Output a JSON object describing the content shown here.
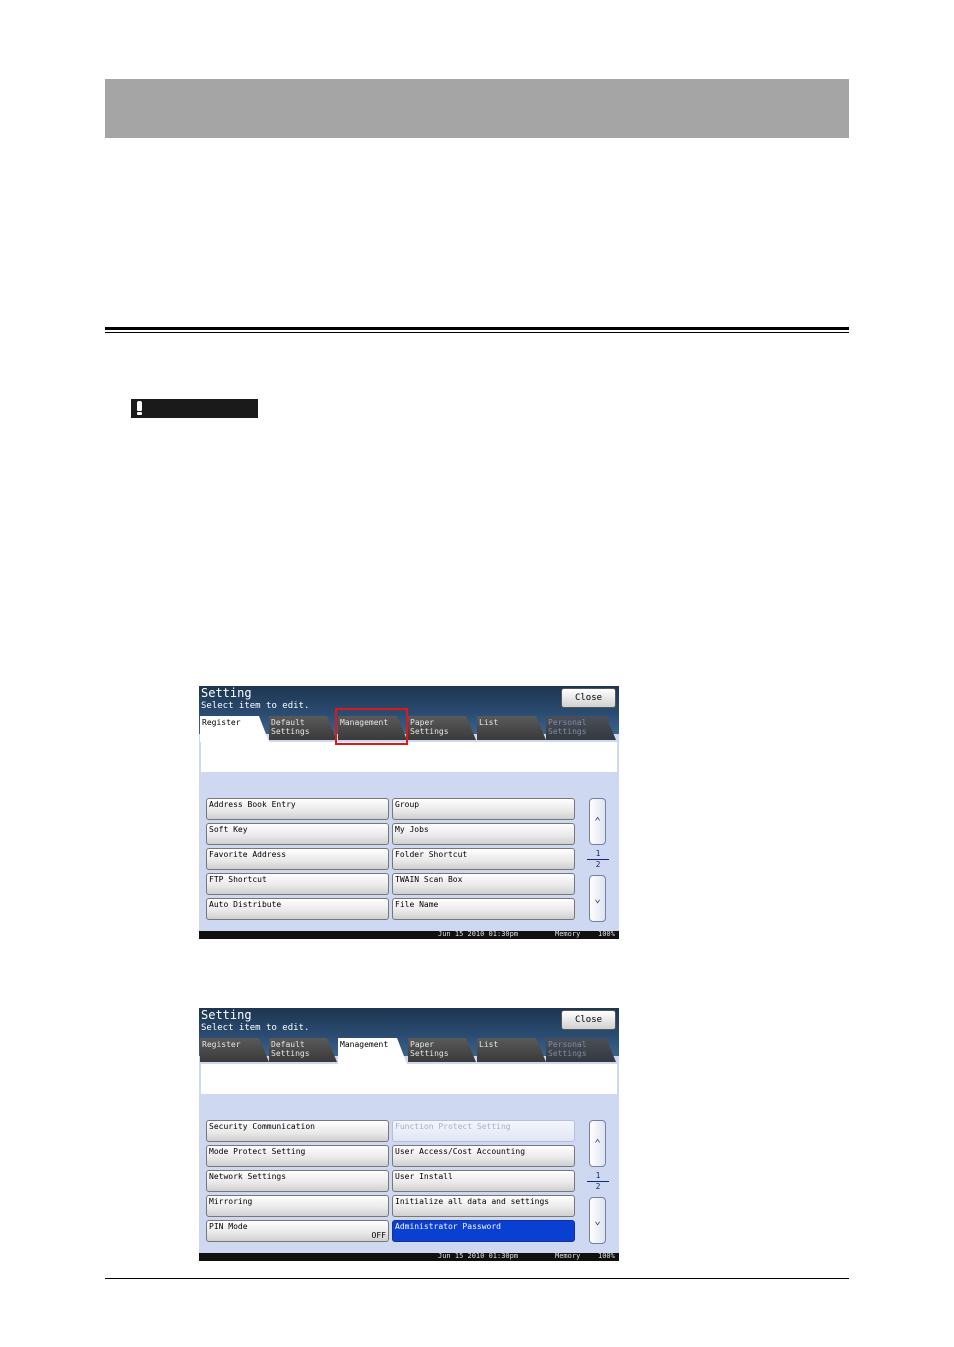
{
  "screenshot1": {
    "title": "Setting",
    "subtitle": "Select item to edit.",
    "close_label": "Close",
    "tabs": [
      {
        "l1": "Register",
        "l2": ""
      },
      {
        "l1": "Default",
        "l2": "Settings"
      },
      {
        "l1": "Management",
        "l2": ""
      },
      {
        "l1": "Paper",
        "l2": "Settings"
      },
      {
        "l1": "List",
        "l2": ""
      },
      {
        "l1": "Personal",
        "l2": "Settings"
      }
    ],
    "active_tab": "Register",
    "buttons_left": [
      "Address Book Entry",
      "Soft Key",
      "Favorite Address",
      "FTP Shortcut",
      "Auto Distribute"
    ],
    "buttons_right": [
      "Group",
      "My Jobs",
      "Folder Shortcut",
      "TWAIN Scan Box",
      "File Name"
    ],
    "page_current": "1",
    "page_total": "2",
    "status_date": "Jun 15 2010 01:30pm",
    "status_memory": "Memory",
    "status_percent": "100%"
  },
  "screenshot2": {
    "title": "Setting",
    "subtitle": "Select item to edit.",
    "close_label": "Close",
    "tabs": [
      {
        "l1": "Register",
        "l2": ""
      },
      {
        "l1": "Default",
        "l2": "Settings"
      },
      {
        "l1": "Management",
        "l2": ""
      },
      {
        "l1": "Paper",
        "l2": "Settings"
      },
      {
        "l1": "List",
        "l2": ""
      },
      {
        "l1": "Personal",
        "l2": "Settings"
      }
    ],
    "active_tab": "Management",
    "buttons_left": [
      "Security Communication",
      "Mode Protect Setting",
      "Network Settings",
      "Mirroring",
      "PIN Mode"
    ],
    "pin_mode_value": "OFF",
    "buttons_right": [
      "Function Protect Setting",
      "User Access/Cost Accounting",
      "User Install",
      "Initialize all data and settings",
      "Administrator Password"
    ],
    "page_current": "1",
    "page_total": "2",
    "status_date": "Jun 15 2010 01:30pm",
    "status_memory": "Memory",
    "status_percent": "100%"
  },
  "colors": {
    "highlight": "#e11717",
    "selected_button": "#0a3fd4",
    "header_band": "#a5a5a5"
  }
}
